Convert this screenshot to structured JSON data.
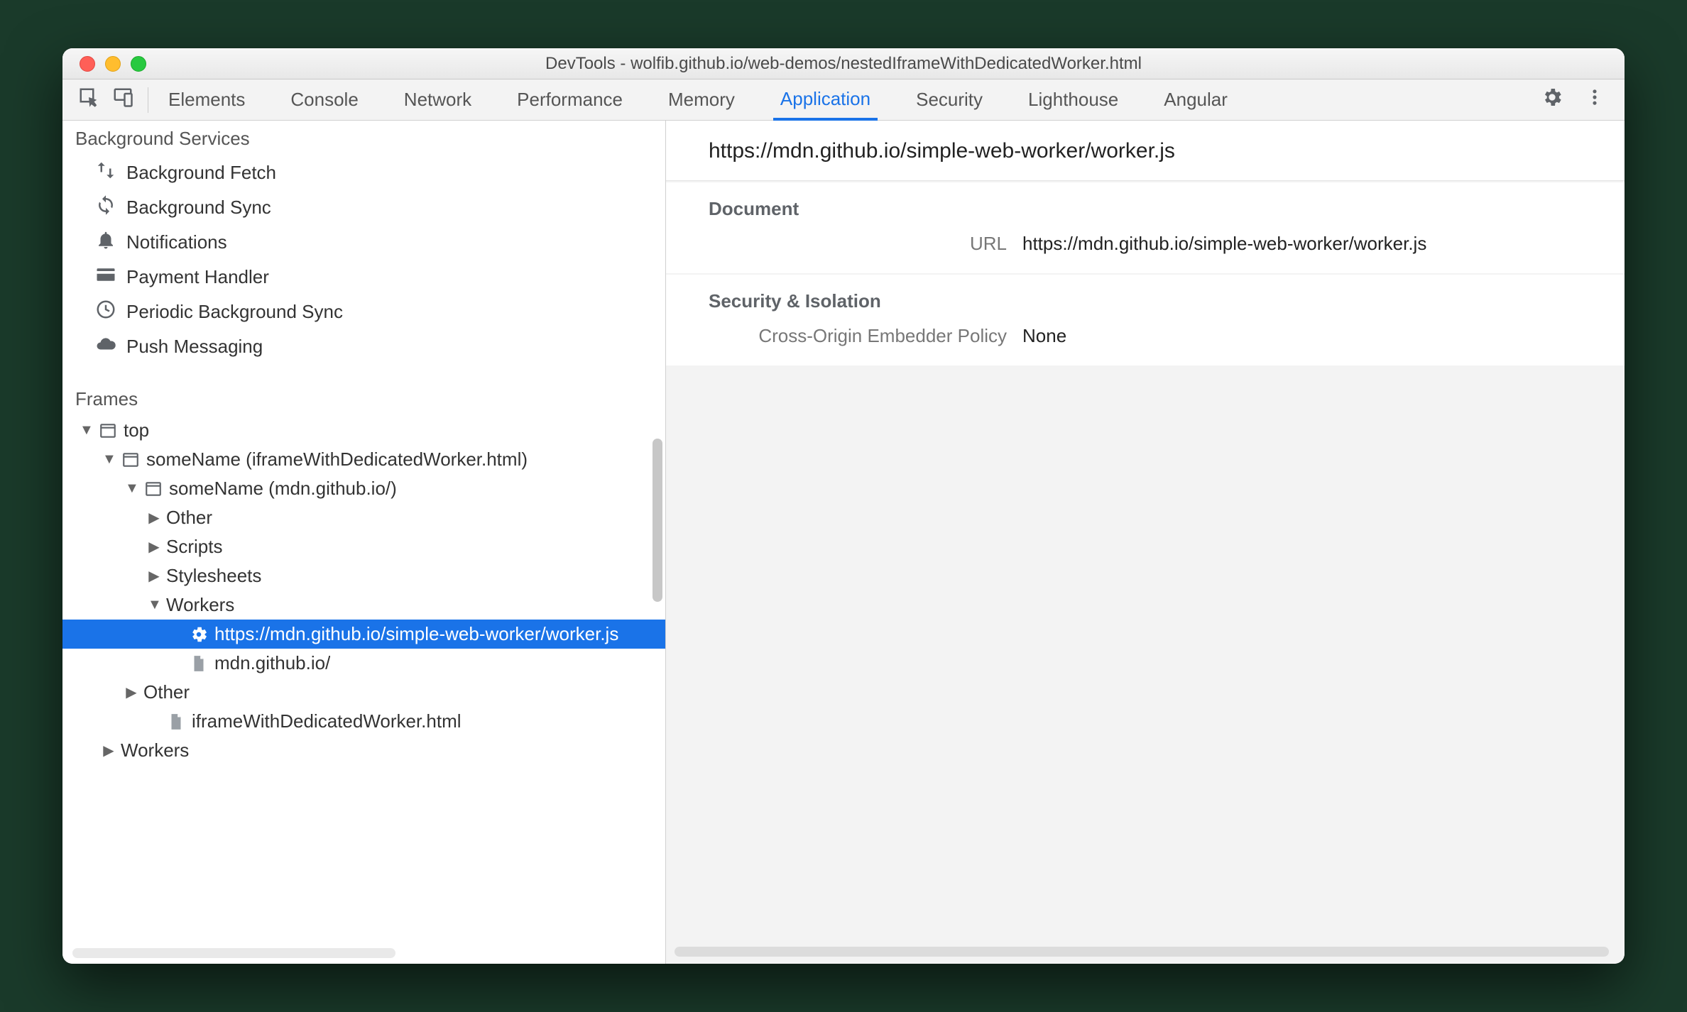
{
  "window": {
    "title": "DevTools - wolfib.github.io/web-demos/nestedIframeWithDedicatedWorker.html"
  },
  "tabs": {
    "items": [
      "Elements",
      "Console",
      "Network",
      "Performance",
      "Memory",
      "Application",
      "Security",
      "Lighthouse",
      "Angular"
    ],
    "active": "Application"
  },
  "sidebar": {
    "bg_section_title": "Background Services",
    "bg_items": [
      {
        "icon": "arrows-updown-icon",
        "label": "Background Fetch"
      },
      {
        "icon": "sync-icon",
        "label": "Background Sync"
      },
      {
        "icon": "bell-icon",
        "label": "Notifications"
      },
      {
        "icon": "card-icon",
        "label": "Payment Handler"
      },
      {
        "icon": "clock-icon",
        "label": "Periodic Background Sync"
      },
      {
        "icon": "cloud-icon",
        "label": "Push Messaging"
      }
    ],
    "frames_title": "Frames",
    "tree": {
      "top": "top",
      "iframe1": "someName (iframeWithDedicatedWorker.html)",
      "iframe2": "someName (mdn.github.io/)",
      "other1": "Other",
      "scripts": "Scripts",
      "stylesheets": "Stylesheets",
      "workers": "Workers",
      "worker_url": "https://mdn.github.io/simple-web-worker/worker.js",
      "doc1": "mdn.github.io/",
      "other2": "Other",
      "doc2": "iframeWithDedicatedWorker.html",
      "workers2": "Workers"
    }
  },
  "detail": {
    "header": "https://mdn.github.io/simple-web-worker/worker.js",
    "doc_section": "Document",
    "url_label": "URL",
    "url_value": "https://mdn.github.io/simple-web-worker/worker.js",
    "sec_section": "Security & Isolation",
    "coep_label": "Cross-Origin Embedder Policy",
    "coep_value": "None"
  }
}
